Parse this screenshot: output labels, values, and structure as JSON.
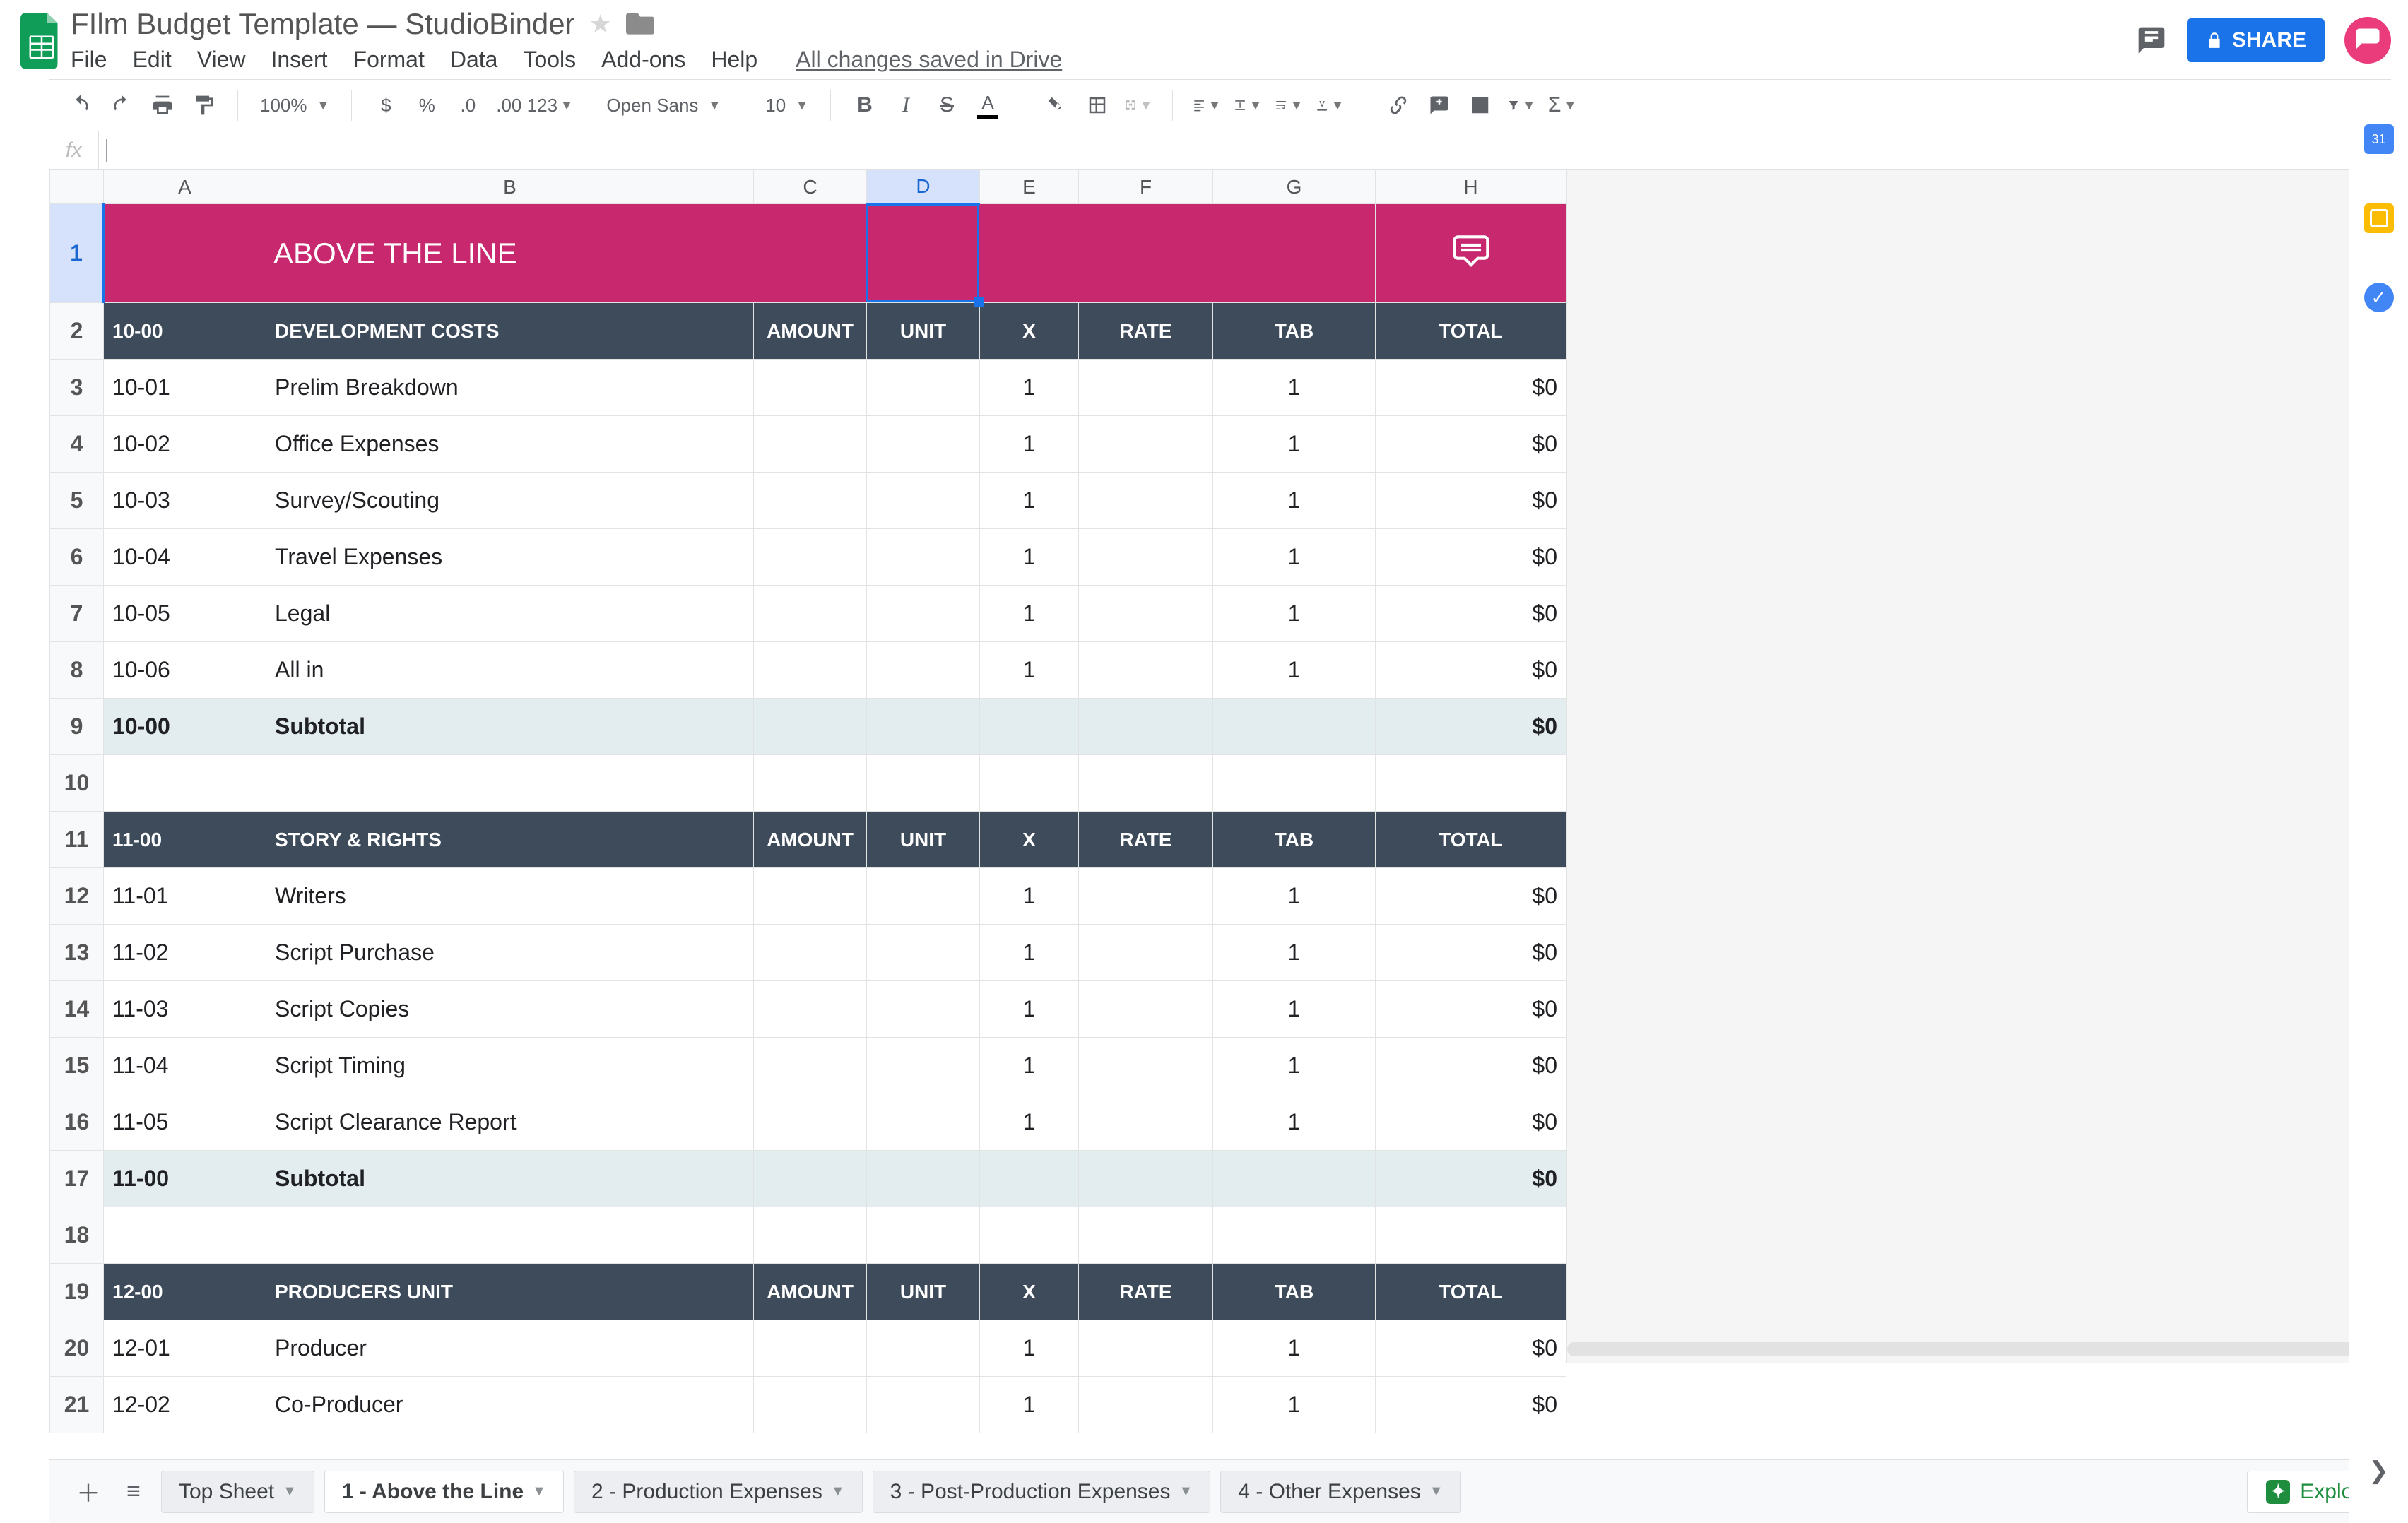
{
  "doc": {
    "title": "FIlm Budget Template — StudioBinder",
    "saved_status": "All changes saved in Drive"
  },
  "menus": [
    "File",
    "Edit",
    "View",
    "Insert",
    "Format",
    "Data",
    "Tools",
    "Add-ons",
    "Help"
  ],
  "share_label": "SHARE",
  "toolbar": {
    "zoom": "100%",
    "font": "Open Sans",
    "font_size": "10",
    "number_group": [
      "$",
      "%",
      ".0",
      ".00",
      "123"
    ]
  },
  "columns": [
    "A",
    "B",
    "C",
    "D",
    "E",
    "F",
    "G",
    "H"
  ],
  "selected_col": "D",
  "header_row": {
    "title": "ABOVE THE LINE"
  },
  "sections": [
    {
      "code": "10-00",
      "name": "DEVELOPMENT COSTS",
      "cols": {
        "amount": "AMOUNT",
        "unit": "UNIT",
        "x": "X",
        "rate": "RATE",
        "tab": "TAB",
        "total": "TOTAL"
      },
      "rows": [
        {
          "num": 3,
          "code": "10-01",
          "name": "Prelim Breakdown",
          "x": "1",
          "tab": "1",
          "total": "$0"
        },
        {
          "num": 4,
          "code": "10-02",
          "name": "Office Expenses",
          "x": "1",
          "tab": "1",
          "total": "$0"
        },
        {
          "num": 5,
          "code": "10-03",
          "name": "Survey/Scouting",
          "x": "1",
          "tab": "1",
          "total": "$0"
        },
        {
          "num": 6,
          "code": "10-04",
          "name": "Travel Expenses",
          "x": "1",
          "tab": "1",
          "total": "$0"
        },
        {
          "num": 7,
          "code": "10-05",
          "name": "Legal",
          "x": "1",
          "tab": "1",
          "total": "$0"
        },
        {
          "num": 8,
          "code": "10-06",
          "name": "All in",
          "x": "1",
          "tab": "1",
          "total": "$0"
        }
      ],
      "subtotal": {
        "num": 9,
        "code": "10-00",
        "label": "Subtotal",
        "total": "$0"
      },
      "blank_after": 10
    },
    {
      "code": "11-00",
      "name": "STORY & RIGHTS",
      "cols": {
        "amount": "AMOUNT",
        "unit": "UNIT",
        "x": "X",
        "rate": "RATE",
        "tab": "TAB",
        "total": "TOTAL"
      },
      "rows": [
        {
          "num": 12,
          "code": "11-01",
          "name": "Writers",
          "x": "1",
          "tab": "1",
          "total": "$0"
        },
        {
          "num": 13,
          "code": "11-02",
          "name": "Script Purchase",
          "x": "1",
          "tab": "1",
          "total": "$0"
        },
        {
          "num": 14,
          "code": "11-03",
          "name": "Script Copies",
          "x": "1",
          "tab": "1",
          "total": "$0"
        },
        {
          "num": 15,
          "code": "11-04",
          "name": "Script Timing",
          "x": "1",
          "tab": "1",
          "total": "$0"
        },
        {
          "num": 16,
          "code": "11-05",
          "name": "Script Clearance Report",
          "x": "1",
          "tab": "1",
          "total": "$0"
        }
      ],
      "subtotal": {
        "num": 17,
        "code": "11-00",
        "label": "Subtotal",
        "total": "$0"
      },
      "blank_after": 18
    },
    {
      "code": "12-00",
      "name": "PRODUCERS UNIT",
      "cols": {
        "amount": "AMOUNT",
        "unit": "UNIT",
        "x": "X",
        "rate": "RATE",
        "tab": "TAB",
        "total": "TOTAL"
      },
      "rows": [
        {
          "num": 20,
          "code": "12-01",
          "name": "Producer",
          "x": "1",
          "tab": "1",
          "total": "$0"
        },
        {
          "num": 21,
          "code": "12-02",
          "name": "Co-Producer",
          "x": "1",
          "tab": "1",
          "total": "$0"
        }
      ]
    }
  ],
  "section_header_rows": [
    2,
    11,
    19
  ],
  "sheet_tabs": [
    "Top Sheet",
    "1 - Above the Line",
    "2 - Production Expenses",
    "3 - Post-Production Expenses",
    "4 - Other Expenses"
  ],
  "active_tab": 1,
  "explore_label": "Explore"
}
